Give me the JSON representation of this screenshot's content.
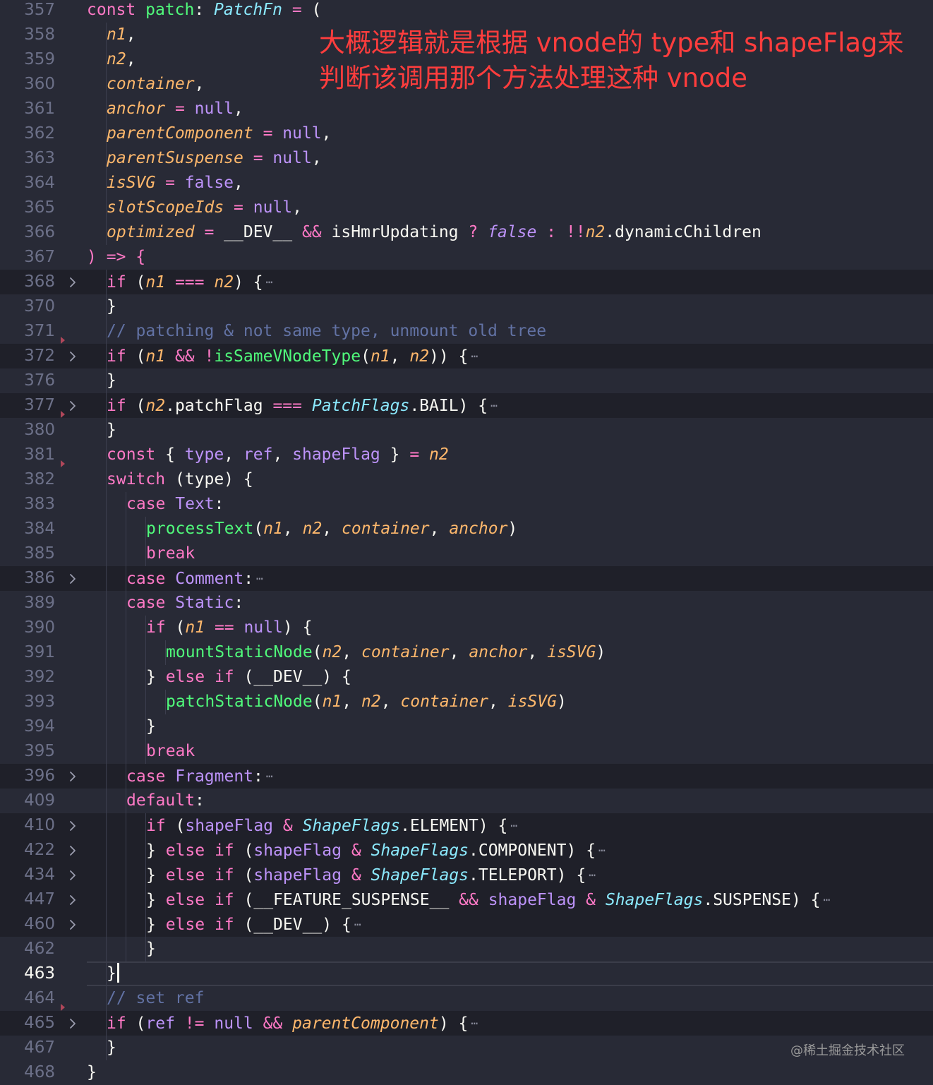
{
  "colors": {
    "background": "#282a36",
    "keyword": "#ff79c6",
    "function": "#50fa7b",
    "parameter": "#ffb86c",
    "type": "#8be9fd",
    "variable": "#bd93f9",
    "comment": "#6272a4",
    "plain": "#f8f8f2",
    "annotation": "#ff3d3d"
  },
  "annotation": {
    "line1": "大概逻辑就是根据 vnode的 type和 shapeFlag来",
    "line2": "判断该调用那个方法处理这种 vnode"
  },
  "watermark": "@稀土掘金技术社区",
  "current_line": "463",
  "lines": [
    {
      "n": "357",
      "indent": 0,
      "tokens": [
        [
          "const ",
          "k"
        ],
        [
          "patch",
          "p"
        ],
        [
          ": ",
          "x"
        ],
        [
          "PatchFn",
          "ti"
        ],
        [
          " = ",
          "k"
        ],
        [
          "(",
          "x"
        ]
      ]
    },
    {
      "n": "358",
      "indent": 1,
      "tokens": [
        [
          "n1",
          "pi"
        ],
        [
          ",",
          "x"
        ]
      ]
    },
    {
      "n": "359",
      "indent": 1,
      "tokens": [
        [
          "n2",
          "pi"
        ],
        [
          ",",
          "x"
        ]
      ]
    },
    {
      "n": "360",
      "indent": 1,
      "tokens": [
        [
          "container",
          "pi"
        ],
        [
          ",",
          "x"
        ]
      ]
    },
    {
      "n": "361",
      "indent": 1,
      "tokens": [
        [
          "anchor",
          "pi"
        ],
        [
          " = ",
          "k"
        ],
        [
          "null",
          "v"
        ],
        [
          ",",
          "x"
        ]
      ]
    },
    {
      "n": "362",
      "indent": 1,
      "tokens": [
        [
          "parentComponent",
          "pi"
        ],
        [
          " = ",
          "k"
        ],
        [
          "null",
          "v"
        ],
        [
          ",",
          "x"
        ]
      ]
    },
    {
      "n": "363",
      "indent": 1,
      "tokens": [
        [
          "parentSuspense",
          "pi"
        ],
        [
          " = ",
          "k"
        ],
        [
          "null",
          "v"
        ],
        [
          ",",
          "x"
        ]
      ]
    },
    {
      "n": "364",
      "indent": 1,
      "tokens": [
        [
          "isSVG",
          "pi"
        ],
        [
          " = ",
          "k"
        ],
        [
          "false",
          "v"
        ],
        [
          ",",
          "x"
        ]
      ]
    },
    {
      "n": "365",
      "indent": 1,
      "tokens": [
        [
          "slotScopeIds",
          "pi"
        ],
        [
          " = ",
          "k"
        ],
        [
          "null",
          "v"
        ],
        [
          ",",
          "x"
        ]
      ]
    },
    {
      "n": "366",
      "indent": 1,
      "tokens": [
        [
          "optimized",
          "pi"
        ],
        [
          " = ",
          "k"
        ],
        [
          "__DEV__",
          "x"
        ],
        [
          " && ",
          "k"
        ],
        [
          "isHmrUpdating",
          "x"
        ],
        [
          " ? ",
          "k"
        ],
        [
          "false",
          "vi"
        ],
        [
          " : ",
          "k"
        ],
        [
          "!!",
          "k"
        ],
        [
          "n2",
          "pi"
        ],
        [
          ".dynamicChildren",
          "x"
        ]
      ]
    },
    {
      "n": "367",
      "indent": 0,
      "tokens": [
        [
          ") ",
          "k"
        ],
        [
          "=> ",
          "k"
        ],
        [
          "{",
          "k"
        ]
      ]
    },
    {
      "n": "368",
      "indent": 1,
      "fold": true,
      "tokens": [
        [
          "if ",
          "k"
        ],
        [
          "(",
          "x"
        ],
        [
          "n1",
          "pi"
        ],
        [
          " === ",
          "k"
        ],
        [
          "n2",
          "pi"
        ],
        [
          ") ",
          "x"
        ],
        [
          "{",
          "x"
        ]
      ]
    },
    {
      "n": "370",
      "indent": 1,
      "tokens": [
        [
          "}",
          "x"
        ]
      ]
    },
    {
      "n": "371",
      "indent": 1,
      "marker": true,
      "tokens": [
        [
          "// patching & not same type, unmount old tree",
          "c"
        ]
      ]
    },
    {
      "n": "372",
      "indent": 1,
      "fold": true,
      "tokens": [
        [
          "if ",
          "k"
        ],
        [
          "(",
          "x"
        ],
        [
          "n1",
          "pi"
        ],
        [
          " && ",
          "k"
        ],
        [
          "!",
          "k"
        ],
        [
          "isSameVNodeType",
          "f"
        ],
        [
          "(",
          "x"
        ],
        [
          "n1",
          "pi"
        ],
        [
          ", ",
          "x"
        ],
        [
          "n2",
          "pi"
        ],
        [
          ")) ",
          "x"
        ],
        [
          "{",
          "x"
        ]
      ]
    },
    {
      "n": "376",
      "indent": 1,
      "tokens": [
        [
          "}",
          "x"
        ]
      ]
    },
    {
      "n": "377",
      "indent": 1,
      "fold": true,
      "marker": true,
      "tokens": [
        [
          "if ",
          "k"
        ],
        [
          "(",
          "x"
        ],
        [
          "n2",
          "pi"
        ],
        [
          ".patchFlag",
          "x"
        ],
        [
          " === ",
          "k"
        ],
        [
          "PatchFlags",
          "ti"
        ],
        [
          ".BAIL",
          "x"
        ],
        [
          ") ",
          "x"
        ],
        [
          "{",
          "x"
        ]
      ]
    },
    {
      "n": "380",
      "indent": 1,
      "tokens": [
        [
          "}",
          "x"
        ]
      ]
    },
    {
      "n": "381",
      "indent": 1,
      "marker": true,
      "tokens": [
        [
          "const ",
          "k"
        ],
        [
          "{ ",
          "x"
        ],
        [
          "type",
          "v"
        ],
        [
          ", ",
          "x"
        ],
        [
          "ref",
          "v"
        ],
        [
          ", ",
          "x"
        ],
        [
          "shapeFlag",
          "v"
        ],
        [
          " } ",
          "x"
        ],
        [
          "= ",
          "k"
        ],
        [
          "n2",
          "pi"
        ]
      ]
    },
    {
      "n": "382",
      "indent": 1,
      "tokens": [
        [
          "switch ",
          "k"
        ],
        [
          "(type) ",
          "x"
        ],
        [
          "{",
          "x"
        ]
      ]
    },
    {
      "n": "383",
      "indent": 2,
      "tokens": [
        [
          "case ",
          "k"
        ],
        [
          "Text",
          "v"
        ],
        [
          ":",
          "x"
        ]
      ]
    },
    {
      "n": "384",
      "indent": 3,
      "tokens": [
        [
          "processText",
          "f"
        ],
        [
          "(",
          "x"
        ],
        [
          "n1",
          "pi"
        ],
        [
          ", ",
          "x"
        ],
        [
          "n2",
          "pi"
        ],
        [
          ", ",
          "x"
        ],
        [
          "container",
          "pi"
        ],
        [
          ", ",
          "x"
        ],
        [
          "anchor",
          "pi"
        ],
        [
          ")",
          "x"
        ]
      ]
    },
    {
      "n": "385",
      "indent": 3,
      "tokens": [
        [
          "break",
          "k"
        ]
      ]
    },
    {
      "n": "386",
      "indent": 2,
      "fold": true,
      "tokens": [
        [
          "case ",
          "k"
        ],
        [
          "Comment",
          "v"
        ],
        [
          ":",
          "x"
        ]
      ]
    },
    {
      "n": "389",
      "indent": 2,
      "tokens": [
        [
          "case ",
          "k"
        ],
        [
          "Static",
          "v"
        ],
        [
          ":",
          "x"
        ]
      ]
    },
    {
      "n": "390",
      "indent": 3,
      "tokens": [
        [
          "if ",
          "k"
        ],
        [
          "(",
          "x"
        ],
        [
          "n1",
          "pi"
        ],
        [
          " == ",
          "k"
        ],
        [
          "null",
          "v"
        ],
        [
          ") ",
          "x"
        ],
        [
          "{",
          "x"
        ]
      ]
    },
    {
      "n": "391",
      "indent": 4,
      "tokens": [
        [
          "mountStaticNode",
          "f"
        ],
        [
          "(",
          "x"
        ],
        [
          "n2",
          "pi"
        ],
        [
          ", ",
          "x"
        ],
        [
          "container",
          "pi"
        ],
        [
          ", ",
          "x"
        ],
        [
          "anchor",
          "pi"
        ],
        [
          ", ",
          "x"
        ],
        [
          "isSVG",
          "pi"
        ],
        [
          ")",
          "x"
        ]
      ]
    },
    {
      "n": "392",
      "indent": 3,
      "tokens": [
        [
          "} ",
          "x"
        ],
        [
          "else if ",
          "k"
        ],
        [
          "(__DEV__) ",
          "x"
        ],
        [
          "{",
          "x"
        ]
      ]
    },
    {
      "n": "393",
      "indent": 4,
      "tokens": [
        [
          "patchStaticNode",
          "f"
        ],
        [
          "(",
          "x"
        ],
        [
          "n1",
          "pi"
        ],
        [
          ", ",
          "x"
        ],
        [
          "n2",
          "pi"
        ],
        [
          ", ",
          "x"
        ],
        [
          "container",
          "pi"
        ],
        [
          ", ",
          "x"
        ],
        [
          "isSVG",
          "pi"
        ],
        [
          ")",
          "x"
        ]
      ]
    },
    {
      "n": "394",
      "indent": 3,
      "tokens": [
        [
          "}",
          "x"
        ]
      ]
    },
    {
      "n": "395",
      "indent": 3,
      "tokens": [
        [
          "break",
          "k"
        ]
      ]
    },
    {
      "n": "396",
      "indent": 2,
      "fold": true,
      "tokens": [
        [
          "case ",
          "k"
        ],
        [
          "Fragment",
          "v"
        ],
        [
          ":",
          "x"
        ]
      ]
    },
    {
      "n": "409",
      "indent": 2,
      "tokens": [
        [
          "default",
          "k"
        ],
        [
          ":",
          "x"
        ]
      ]
    },
    {
      "n": "410",
      "indent": 3,
      "fold": true,
      "tokens": [
        [
          "if ",
          "k"
        ],
        [
          "(",
          "x"
        ],
        [
          "shapeFlag",
          "v"
        ],
        [
          " & ",
          "k"
        ],
        [
          "ShapeFlags",
          "ti"
        ],
        [
          ".ELEMENT",
          "x"
        ],
        [
          ") ",
          "x"
        ],
        [
          "{",
          "x"
        ]
      ]
    },
    {
      "n": "422",
      "indent": 3,
      "fold": true,
      "tokens": [
        [
          "} ",
          "x"
        ],
        [
          "else if ",
          "k"
        ],
        [
          "(",
          "x"
        ],
        [
          "shapeFlag",
          "v"
        ],
        [
          " & ",
          "k"
        ],
        [
          "ShapeFlags",
          "ti"
        ],
        [
          ".COMPONENT",
          "x"
        ],
        [
          ") ",
          "x"
        ],
        [
          "{",
          "x"
        ]
      ]
    },
    {
      "n": "434",
      "indent": 3,
      "fold": true,
      "tokens": [
        [
          "} ",
          "x"
        ],
        [
          "else if ",
          "k"
        ],
        [
          "(",
          "x"
        ],
        [
          "shapeFlag",
          "v"
        ],
        [
          " & ",
          "k"
        ],
        [
          "ShapeFlags",
          "ti"
        ],
        [
          ".TELEPORT",
          "x"
        ],
        [
          ") ",
          "x"
        ],
        [
          "{",
          "x"
        ]
      ]
    },
    {
      "n": "447",
      "indent": 3,
      "fold": true,
      "tokens": [
        [
          "} ",
          "x"
        ],
        [
          "else if ",
          "k"
        ],
        [
          "(",
          "x"
        ],
        [
          "__FEATURE_SUSPENSE__",
          "x"
        ],
        [
          " && ",
          "k"
        ],
        [
          "shapeFlag",
          "v"
        ],
        [
          " & ",
          "k"
        ],
        [
          "ShapeFlags",
          "ti"
        ],
        [
          ".SUSPENSE",
          "x"
        ],
        [
          ") ",
          "x"
        ],
        [
          "{",
          "x"
        ]
      ]
    },
    {
      "n": "460",
      "indent": 3,
      "fold": true,
      "tokens": [
        [
          "} ",
          "x"
        ],
        [
          "else if ",
          "k"
        ],
        [
          "(__DEV__) ",
          "x"
        ],
        [
          "{",
          "x"
        ]
      ]
    },
    {
      "n": "462",
      "indent": 3,
      "tokens": [
        [
          "}",
          "x"
        ]
      ]
    },
    {
      "n": "463",
      "indent": 1,
      "current": true,
      "tokens": [
        [
          "}",
          "x"
        ]
      ]
    },
    {
      "n": "464",
      "indent": 1,
      "marker": true,
      "tokens": [
        [
          "// set ref",
          "c"
        ]
      ]
    },
    {
      "n": "465",
      "indent": 1,
      "fold": true,
      "tokens": [
        [
          "if ",
          "k"
        ],
        [
          "(",
          "x"
        ],
        [
          "ref",
          "v"
        ],
        [
          " != ",
          "k"
        ],
        [
          "null",
          "v"
        ],
        [
          " && ",
          "k"
        ],
        [
          "parentComponent",
          "pi"
        ],
        [
          ") ",
          "x"
        ],
        [
          "{",
          "x"
        ]
      ]
    },
    {
      "n": "467",
      "indent": 1,
      "tokens": [
        [
          "}",
          "x"
        ]
      ]
    },
    {
      "n": "468",
      "indent": 0,
      "tokens": [
        [
          "}",
          "x"
        ]
      ]
    }
  ]
}
